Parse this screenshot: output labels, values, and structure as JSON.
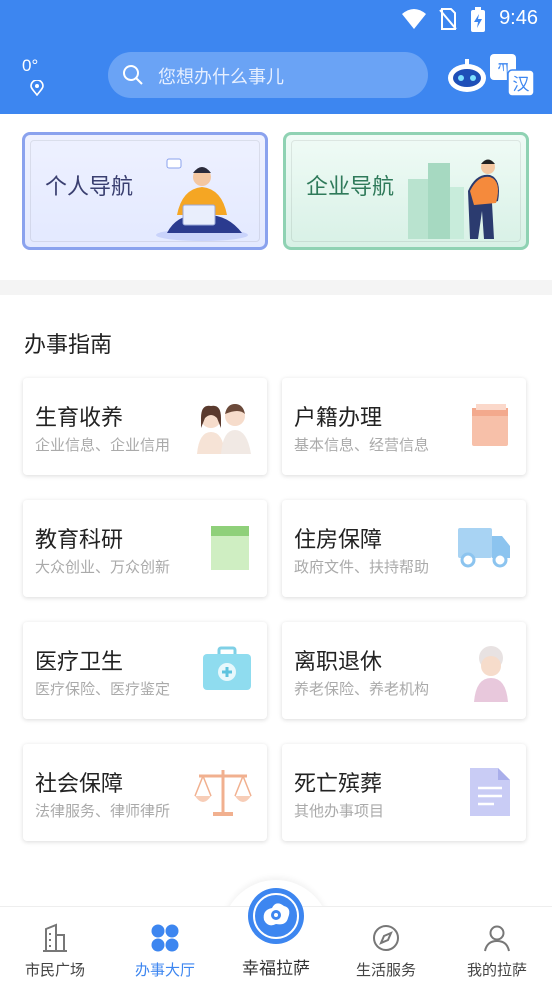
{
  "status": {
    "time": "9:46"
  },
  "header": {
    "temperature": "0°",
    "search_placeholder": "您想办什么事儿"
  },
  "nav_cards": [
    {
      "label": "个人导航"
    },
    {
      "label": "企业导航"
    }
  ],
  "guide": {
    "title": "办事指南",
    "items": [
      {
        "title": "生育收养",
        "subtitle": "企业信息、企业信用"
      },
      {
        "title": "户籍办理",
        "subtitle": "基本信息、经营信息"
      },
      {
        "title": "教育科研",
        "subtitle": "大众创业、万众创新"
      },
      {
        "title": "住房保障",
        "subtitle": "政府文件、扶持帮助"
      },
      {
        "title": "医疗卫生",
        "subtitle": "医疗保险、医疗鉴定"
      },
      {
        "title": "离职退休",
        "subtitle": "养老保险、养老机构"
      },
      {
        "title": "社会保障",
        "subtitle": "法律服务、律师律所"
      },
      {
        "title": "死亡殡葬",
        "subtitle": "其他办事项目"
      }
    ]
  },
  "bottom_nav": {
    "tabs": [
      {
        "label": "市民广场"
      },
      {
        "label": "办事大厅"
      },
      {
        "label": "幸福拉萨"
      },
      {
        "label": "生活服务"
      },
      {
        "label": "我的拉萨"
      }
    ],
    "active": "办事大厅"
  },
  "colors": {
    "primary": "#3d86f0"
  }
}
